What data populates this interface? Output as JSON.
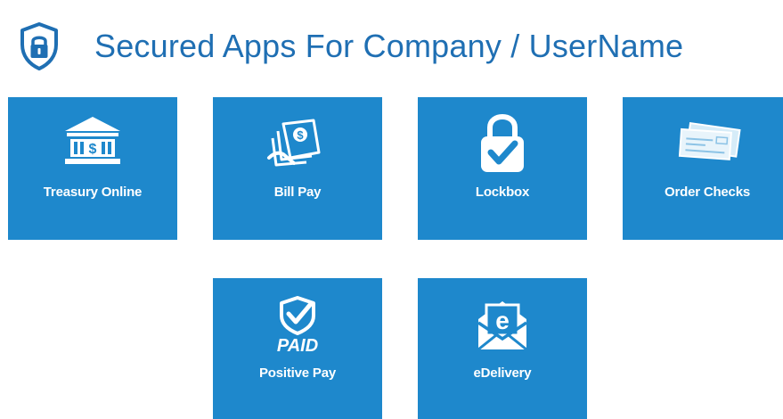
{
  "header": {
    "title": "Secured Apps For Company / UserName",
    "icon": "shield-lock-icon"
  },
  "colors": {
    "accent": "#1f6fb3",
    "tile": "#1e88cc",
    "tile_text": "#ffffff"
  },
  "apps": [
    {
      "label": "Treasury Online",
      "icon": "bank-icon"
    },
    {
      "label": "Bill Pay",
      "icon": "money-bills-icon"
    },
    {
      "label": "Lockbox",
      "icon": "padlock-check-icon"
    },
    {
      "label": "Order Checks",
      "icon": "checks-icon"
    },
    {
      "label": "Positive Pay",
      "icon": "shield-check-paid-icon",
      "badge": "PAID"
    },
    {
      "label": "eDelivery",
      "icon": "envelope-e-icon",
      "badge": "e"
    }
  ]
}
